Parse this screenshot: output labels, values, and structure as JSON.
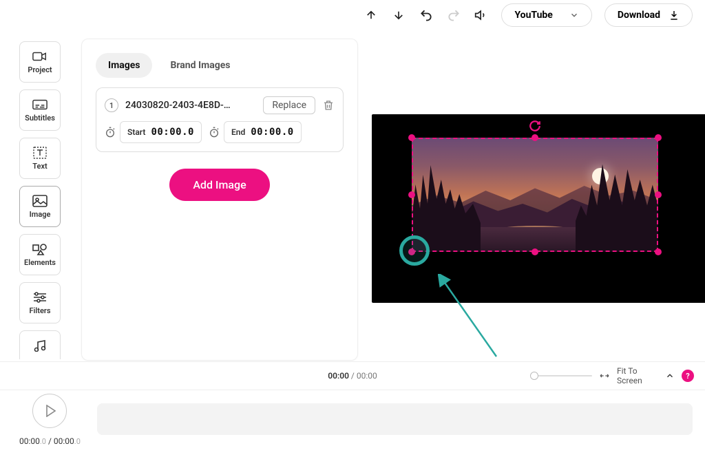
{
  "topbar": {
    "platform": "YouTube",
    "download": "Download"
  },
  "sidebar": {
    "items": [
      {
        "label": "Project"
      },
      {
        "label": "Subtitles"
      },
      {
        "label": "Text"
      },
      {
        "label": "Image"
      },
      {
        "label": "Elements"
      },
      {
        "label": "Filters"
      },
      {
        "label": ""
      }
    ],
    "active_index": 3
  },
  "panel": {
    "tabs": [
      {
        "label": "Images"
      },
      {
        "label": "Brand Images"
      }
    ],
    "active_tab": 0,
    "image_card": {
      "index": "1",
      "filename": "24030820-2403-4E8D-…",
      "replace_label": "Replace",
      "start_label": "Start",
      "start_value": "00:00.0",
      "end_label": "End",
      "end_value": "00:00.0"
    },
    "add_button": "Add Image"
  },
  "controls": {
    "current_time": "00:00",
    "total_time": "00:00",
    "fit_label": "Fit To Screen",
    "help": "?"
  },
  "timeline": {
    "current": "00:00",
    "current_frac": ".0",
    "total": "00:00",
    "total_frac": ".0"
  }
}
